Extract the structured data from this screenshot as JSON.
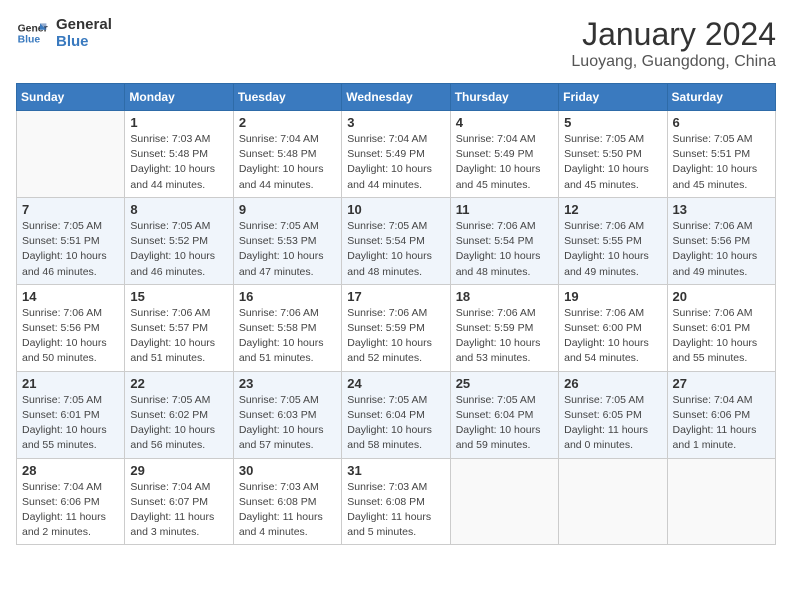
{
  "header": {
    "logo_line1": "General",
    "logo_line2": "Blue",
    "month_title": "January 2024",
    "location": "Luoyang, Guangdong, China"
  },
  "days_of_week": [
    "Sunday",
    "Monday",
    "Tuesday",
    "Wednesday",
    "Thursday",
    "Friday",
    "Saturday"
  ],
  "weeks": [
    [
      {
        "day": "",
        "info": ""
      },
      {
        "day": "1",
        "info": "Sunrise: 7:03 AM\nSunset: 5:48 PM\nDaylight: 10 hours\nand 44 minutes."
      },
      {
        "day": "2",
        "info": "Sunrise: 7:04 AM\nSunset: 5:48 PM\nDaylight: 10 hours\nand 44 minutes."
      },
      {
        "day": "3",
        "info": "Sunrise: 7:04 AM\nSunset: 5:49 PM\nDaylight: 10 hours\nand 44 minutes."
      },
      {
        "day": "4",
        "info": "Sunrise: 7:04 AM\nSunset: 5:49 PM\nDaylight: 10 hours\nand 45 minutes."
      },
      {
        "day": "5",
        "info": "Sunrise: 7:05 AM\nSunset: 5:50 PM\nDaylight: 10 hours\nand 45 minutes."
      },
      {
        "day": "6",
        "info": "Sunrise: 7:05 AM\nSunset: 5:51 PM\nDaylight: 10 hours\nand 45 minutes."
      }
    ],
    [
      {
        "day": "7",
        "info": "Sunrise: 7:05 AM\nSunset: 5:51 PM\nDaylight: 10 hours\nand 46 minutes."
      },
      {
        "day": "8",
        "info": "Sunrise: 7:05 AM\nSunset: 5:52 PM\nDaylight: 10 hours\nand 46 minutes."
      },
      {
        "day": "9",
        "info": "Sunrise: 7:05 AM\nSunset: 5:53 PM\nDaylight: 10 hours\nand 47 minutes."
      },
      {
        "day": "10",
        "info": "Sunrise: 7:05 AM\nSunset: 5:54 PM\nDaylight: 10 hours\nand 48 minutes."
      },
      {
        "day": "11",
        "info": "Sunrise: 7:06 AM\nSunset: 5:54 PM\nDaylight: 10 hours\nand 48 minutes."
      },
      {
        "day": "12",
        "info": "Sunrise: 7:06 AM\nSunset: 5:55 PM\nDaylight: 10 hours\nand 49 minutes."
      },
      {
        "day": "13",
        "info": "Sunrise: 7:06 AM\nSunset: 5:56 PM\nDaylight: 10 hours\nand 49 minutes."
      }
    ],
    [
      {
        "day": "14",
        "info": "Sunrise: 7:06 AM\nSunset: 5:56 PM\nDaylight: 10 hours\nand 50 minutes."
      },
      {
        "day": "15",
        "info": "Sunrise: 7:06 AM\nSunset: 5:57 PM\nDaylight: 10 hours\nand 51 minutes."
      },
      {
        "day": "16",
        "info": "Sunrise: 7:06 AM\nSunset: 5:58 PM\nDaylight: 10 hours\nand 51 minutes."
      },
      {
        "day": "17",
        "info": "Sunrise: 7:06 AM\nSunset: 5:59 PM\nDaylight: 10 hours\nand 52 minutes."
      },
      {
        "day": "18",
        "info": "Sunrise: 7:06 AM\nSunset: 5:59 PM\nDaylight: 10 hours\nand 53 minutes."
      },
      {
        "day": "19",
        "info": "Sunrise: 7:06 AM\nSunset: 6:00 PM\nDaylight: 10 hours\nand 54 minutes."
      },
      {
        "day": "20",
        "info": "Sunrise: 7:06 AM\nSunset: 6:01 PM\nDaylight: 10 hours\nand 55 minutes."
      }
    ],
    [
      {
        "day": "21",
        "info": "Sunrise: 7:05 AM\nSunset: 6:01 PM\nDaylight: 10 hours\nand 55 minutes."
      },
      {
        "day": "22",
        "info": "Sunrise: 7:05 AM\nSunset: 6:02 PM\nDaylight: 10 hours\nand 56 minutes."
      },
      {
        "day": "23",
        "info": "Sunrise: 7:05 AM\nSunset: 6:03 PM\nDaylight: 10 hours\nand 57 minutes."
      },
      {
        "day": "24",
        "info": "Sunrise: 7:05 AM\nSunset: 6:04 PM\nDaylight: 10 hours\nand 58 minutes."
      },
      {
        "day": "25",
        "info": "Sunrise: 7:05 AM\nSunset: 6:04 PM\nDaylight: 10 hours\nand 59 minutes."
      },
      {
        "day": "26",
        "info": "Sunrise: 7:05 AM\nSunset: 6:05 PM\nDaylight: 11 hours\nand 0 minutes."
      },
      {
        "day": "27",
        "info": "Sunrise: 7:04 AM\nSunset: 6:06 PM\nDaylight: 11 hours\nand 1 minute."
      }
    ],
    [
      {
        "day": "28",
        "info": "Sunrise: 7:04 AM\nSunset: 6:06 PM\nDaylight: 11 hours\nand 2 minutes."
      },
      {
        "day": "29",
        "info": "Sunrise: 7:04 AM\nSunset: 6:07 PM\nDaylight: 11 hours\nand 3 minutes."
      },
      {
        "day": "30",
        "info": "Sunrise: 7:03 AM\nSunset: 6:08 PM\nDaylight: 11 hours\nand 4 minutes."
      },
      {
        "day": "31",
        "info": "Sunrise: 7:03 AM\nSunset: 6:08 PM\nDaylight: 11 hours\nand 5 minutes."
      },
      {
        "day": "",
        "info": ""
      },
      {
        "day": "",
        "info": ""
      },
      {
        "day": "",
        "info": ""
      }
    ]
  ]
}
